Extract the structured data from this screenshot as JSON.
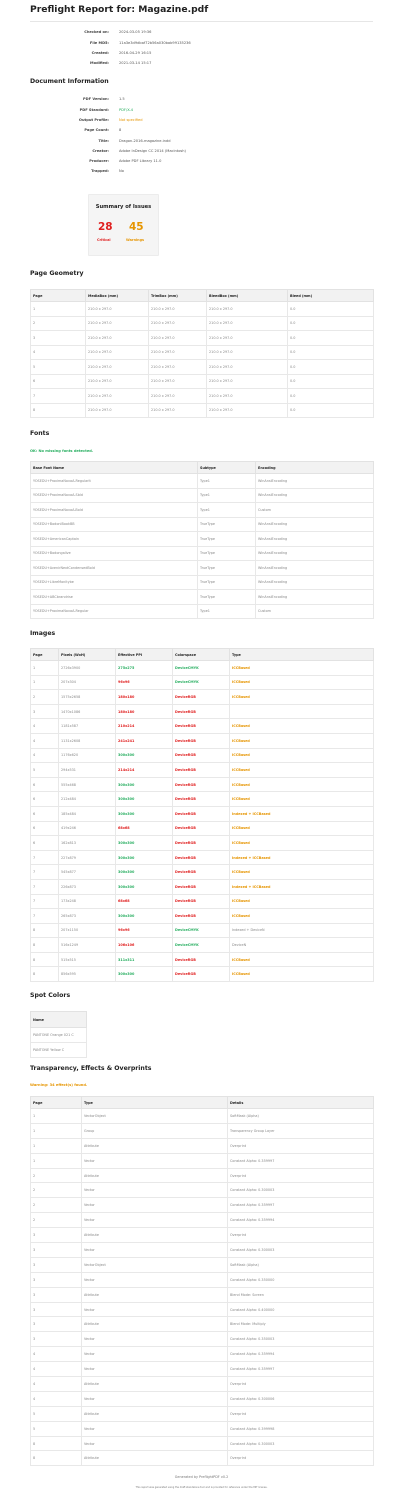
{
  "report": {
    "title": "Preflight Report for: Magazine.pdf",
    "meta": [
      {
        "key": "Checked on:",
        "value": "2024-03-05 19:36"
      },
      {
        "key": "File MD5:",
        "value": "11a3e3d9dbaf72b56a030bab99135236"
      },
      {
        "key": "Created:",
        "value": "2016-04-29 16:15"
      },
      {
        "key": "Modified:",
        "value": "2021-03-14 15:17"
      }
    ]
  },
  "document_info": {
    "heading": "Document Information",
    "rows": [
      {
        "key": "PDF Version:",
        "value": "1.5",
        "status": ""
      },
      {
        "key": "PDF Standard:",
        "value": "PDF/X-4",
        "status": "ok"
      },
      {
        "key": "Output Profile:",
        "value": "Not specified",
        "status": "warn"
      },
      {
        "key": "Page Count:",
        "value": "8",
        "status": ""
      },
      {
        "key": "Title:",
        "value": "Dragon-2016-magazine.indd",
        "status": ""
      },
      {
        "key": "Creator:",
        "value": "Adobe InDesign CC 2014 (Macintosh)",
        "status": ""
      },
      {
        "key": "Producer:",
        "value": "Adobe PDF Library 11.0",
        "status": ""
      },
      {
        "key": "Trapped:",
        "value": "No",
        "status": ""
      }
    ]
  },
  "summary": {
    "title": "Summary of Issues",
    "critical_count": "28",
    "critical_label": "Critical",
    "warnings_count": "45",
    "warnings_label": "Warnings"
  },
  "page_geometry": {
    "heading": "Page Geometry",
    "columns": [
      "Page",
      "MediaBox (mm)",
      "TrimBox (mm)",
      "BleedBox (mm)",
      "Bleed (mm)"
    ],
    "rows": [
      [
        "1",
        "210.0 x 297.0",
        "210.0 x 297.0",
        "210.0 x 297.0",
        "0.0"
      ],
      [
        "2",
        "210.0 x 297.0",
        "210.0 x 297.0",
        "210.0 x 297.0",
        "0.0"
      ],
      [
        "3",
        "210.0 x 297.0",
        "210.0 x 297.0",
        "210.0 x 297.0",
        "0.0"
      ],
      [
        "4",
        "210.0 x 297.0",
        "210.0 x 297.0",
        "210.0 x 297.0",
        "0.0"
      ],
      [
        "5",
        "210.0 x 297.0",
        "210.0 x 297.0",
        "210.0 x 297.0",
        "0.0"
      ],
      [
        "6",
        "210.0 x 297.0",
        "210.0 x 297.0",
        "210.0 x 297.0",
        "0.0"
      ],
      [
        "7",
        "210.0 x 297.0",
        "210.0 x 297.0",
        "210.0 x 297.0",
        "0.0"
      ],
      [
        "8",
        "210.0 x 297.0",
        "210.0 x 297.0",
        "210.0 x 297.0",
        "0.0"
      ]
    ]
  },
  "fonts": {
    "heading": "Fonts",
    "note": "OK: No missing fonts detected.",
    "columns": [
      "Base Font Name",
      "Subtype",
      "Encoding"
    ],
    "rows": [
      [
        "YOSEDU+ProximaNovaA-Regularlt",
        "Type1",
        "WinAnsiEncoding"
      ],
      [
        "YOSEDU+ProximaNovaA-Sbld",
        "Type1",
        "WinAnsiEncoding"
      ],
      [
        "YOSEDU+ProximaNovaA-Bold",
        "Type1",
        "Custom"
      ],
      [
        "YOSEDU+BodoniBookBB",
        "TrueType",
        "WinAnsiEncoding"
      ],
      [
        "YOSEDU+AmericanCaptain",
        "TrueType",
        "WinAnsiEncoding"
      ],
      [
        "YOSEDU+Bodongalive",
        "TrueType",
        "WinAnsiEncoding"
      ],
      [
        "YOSEDU+AvenirNextCondensedBold",
        "TrueType",
        "WinAnsiEncoding"
      ],
      [
        "YOSEDU+LibreMonitybe",
        "TrueType",
        "WinAnsiEncoding"
      ],
      [
        "YOSEDU+ABCbrandrise",
        "TrueType",
        "WinAnsiEncoding"
      ],
      [
        "YOSEDU+ProximaNovaA-Regular",
        "Type1",
        "Custom"
      ]
    ]
  },
  "images": {
    "heading": "Images",
    "columns": [
      "Page",
      "Pixels (WxH)",
      "Effective PPI",
      "Colorspace",
      "Type"
    ],
    "rows": [
      [
        "1",
        "2726x3900",
        "275x275",
        "DeviceCMYK",
        "ICCBased",
        "ok",
        "ok",
        "warn"
      ],
      [
        "1",
        "207x304",
        "96x96",
        "DeviceCMYK",
        "ICCBased",
        "bad",
        "ok",
        "warn"
      ],
      [
        "2",
        "1575x2658",
        "180x180",
        "DeviceRGB",
        "ICCBased",
        "bad",
        "bad",
        "warn"
      ],
      [
        "3",
        "1470x1086",
        "180x180",
        "DeviceRGB",
        "",
        "bad",
        "bad",
        ""
      ],
      [
        "4",
        "1181x587",
        "210x214",
        "DeviceRGB",
        "ICCBased",
        "bad",
        "bad",
        "warn"
      ],
      [
        "4",
        "1131x2608",
        "241x241",
        "DeviceRGB",
        "ICCBased",
        "bad",
        "bad",
        "warn"
      ],
      [
        "4",
        "1176x620",
        "300x300",
        "DeviceRGB",
        "ICCBased",
        "ok",
        "bad",
        "warn"
      ],
      [
        "5",
        "294x531",
        "214x214",
        "DeviceRGB",
        "ICCBased",
        "bad",
        "bad",
        "warn"
      ],
      [
        "6",
        "555x468",
        "300x300",
        "DeviceRGB",
        "ICCBased",
        "ok",
        "bad",
        "warn"
      ],
      [
        "6",
        "212x484",
        "300x300",
        "DeviceRGB",
        "ICCBased",
        "ok",
        "bad",
        "warn"
      ],
      [
        "6",
        "185x484",
        "300x300",
        "DeviceRGB",
        "Indexed + ICCBased",
        "ok",
        "bad",
        "warn"
      ],
      [
        "6",
        "419x246",
        "68x68",
        "DeviceRGB",
        "ICCBased",
        "bad",
        "bad",
        "warn"
      ],
      [
        "6",
        "162x813",
        "300x300",
        "DeviceRGB",
        "ICCBased",
        "ok",
        "bad",
        "warn"
      ],
      [
        "7",
        "227x879",
        "300x300",
        "DeviceRGB",
        "Indexed + ICCBased",
        "ok",
        "bad",
        "warn"
      ],
      [
        "7",
        "545x877",
        "300x300",
        "DeviceRGB",
        "ICCBased",
        "ok",
        "bad",
        "warn"
      ],
      [
        "7",
        "226x873",
        "300x300",
        "DeviceRGB",
        "Indexed + ICCBased",
        "ok",
        "bad",
        "warn"
      ],
      [
        "7",
        "173x248",
        "68x68",
        "DeviceRGB",
        "ICCBased",
        "bad",
        "bad",
        "warn"
      ],
      [
        "7",
        "265x873",
        "300x300",
        "DeviceRGB",
        "ICCBased",
        "ok",
        "bad",
        "warn"
      ],
      [
        "8",
        "207x1150",
        "96x96",
        "DeviceCMYK",
        "Indexed + DeviceN",
        "bad",
        "ok",
        "plain"
      ],
      [
        "8",
        "516x1249",
        "106x106",
        "DeviceCMYK",
        "DeviceN",
        "bad",
        "ok",
        "plain"
      ],
      [
        "8",
        "515x515",
        "311x311",
        "DeviceRGB",
        "ICCBased",
        "ok",
        "bad",
        "warn"
      ],
      [
        "8",
        "856x595",
        "300x300",
        "DeviceRGB",
        "ICCBased",
        "ok",
        "bad",
        "warn"
      ]
    ]
  },
  "spot_colors": {
    "heading": "Spot Colors",
    "columns": [
      "Name"
    ],
    "rows": [
      [
        "PANTONE Orange 021 C"
      ],
      [
        "PANTONE Yellow C"
      ]
    ]
  },
  "transparency": {
    "heading": "Transparency, Effects & Overprints",
    "note": "Warning: 34 effect(s) found.",
    "columns": [
      "Page",
      "Type",
      "Details"
    ],
    "rows": [
      [
        "1",
        "VectorObject",
        "SoftMask (Alpha)"
      ],
      [
        "1",
        "Group",
        "Transparency Group Layer"
      ],
      [
        "1",
        "Attribute",
        "Overprint"
      ],
      [
        "1",
        "Vector",
        "Constant Alpha: 0.359997"
      ],
      [
        "2",
        "Attribute",
        "Overprint"
      ],
      [
        "2",
        "Vector",
        "Constant Alpha: 0.300003"
      ],
      [
        "2",
        "Vector",
        "Constant Alpha: 0.359997"
      ],
      [
        "2",
        "Vector",
        "Constant Alpha: 0.359994"
      ],
      [
        "3",
        "Attribute",
        "Overprint"
      ],
      [
        "3",
        "Vector",
        "Constant Alpha: 0.300003"
      ],
      [
        "3",
        "VectorObject",
        "SoftMask (Alpha)"
      ],
      [
        "3",
        "Vector",
        "Constant Alpha: 0.350000"
      ],
      [
        "3",
        "Attribute",
        "Blend Mode: Screen"
      ],
      [
        "3",
        "Vector",
        "Constant Alpha: 0.400000"
      ],
      [
        "3",
        "Attribute",
        "Blend Mode: Multiply"
      ],
      [
        "3",
        "Vector",
        "Constant Alpha: 0.350003"
      ],
      [
        "4",
        "Vector",
        "Constant Alpha: 0.359994"
      ],
      [
        "4",
        "Vector",
        "Constant Alpha: 0.359997"
      ],
      [
        "4",
        "Attribute",
        "Overprint"
      ],
      [
        "4",
        "Vector",
        "Constant Alpha: 0.300006"
      ],
      [
        "5",
        "Attribute",
        "Overprint"
      ],
      [
        "5",
        "Vector",
        "Constant Alpha: 0.399998"
      ],
      [
        "8",
        "Vector",
        "Constant Alpha: 0.300003"
      ],
      [
        "8",
        "Attribute",
        "Overprint"
      ]
    ]
  },
  "footer": {
    "generated": "Generated by PreflightPDF v0.2",
    "disclaimer": "This report was generated using the draft standalone tool and is provided for reference under the MIT license."
  },
  "colors": {
    "ok": "#27ae60",
    "warn": "#e69500",
    "bad": "#e02020",
    "header_bg": "#f2f2f2"
  }
}
